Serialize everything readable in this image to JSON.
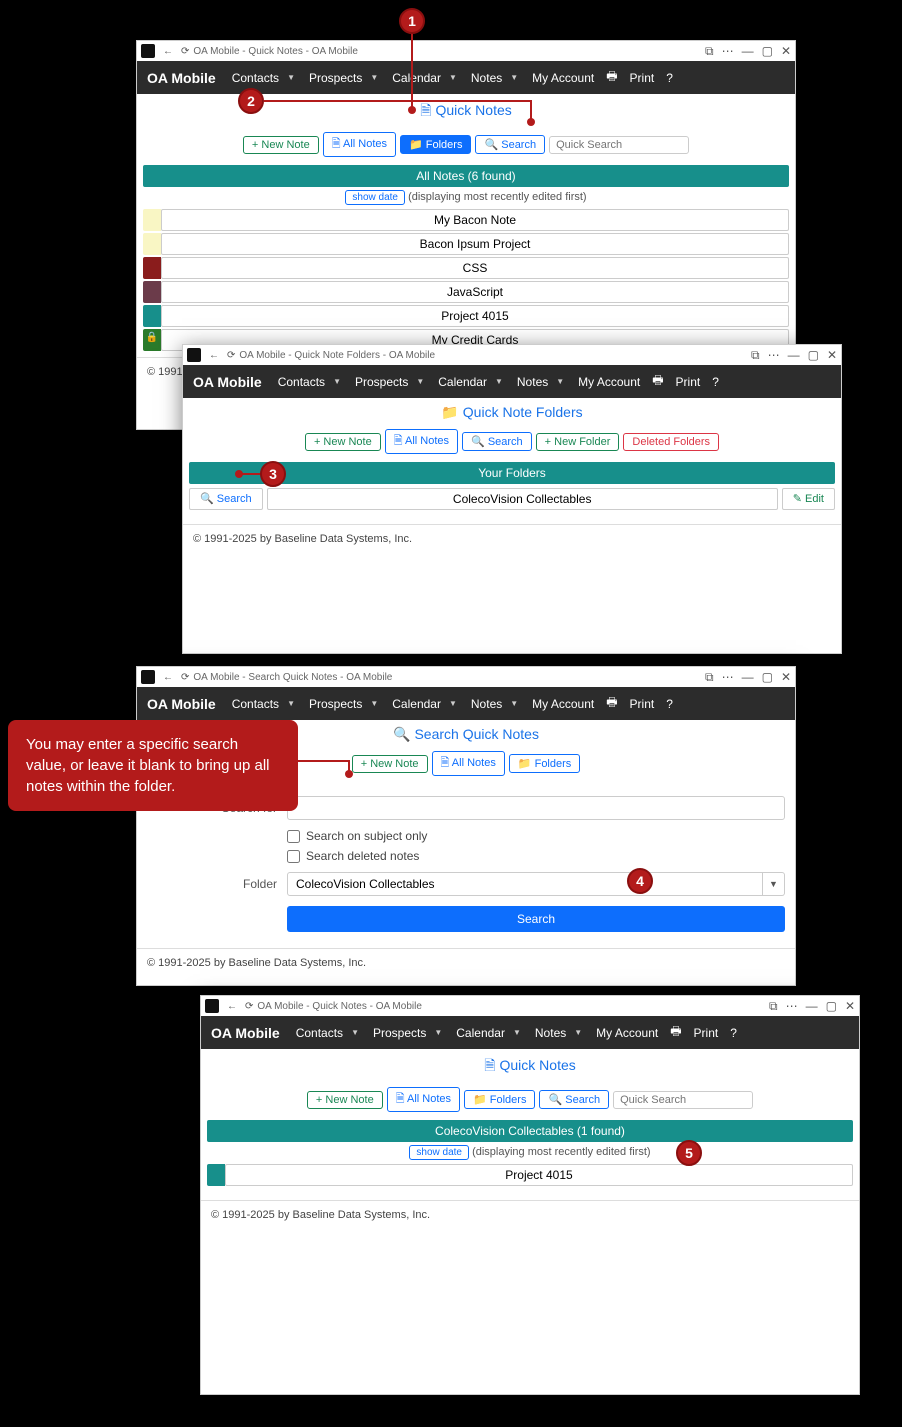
{
  "common": {
    "brand": "OA Mobile",
    "menu": [
      "Contacts",
      "Prospects",
      "Calendar",
      "Notes",
      "My Account"
    ],
    "print": "Print",
    "help": "?",
    "footer": "© 1991-2025 by Baseline Data Systems, Inc.",
    "btn_new_note": "+ New Note",
    "btn_all_notes": "All Notes",
    "btn_folders": "Folders",
    "btn_search": "Search",
    "quick_search_ph": "Quick Search",
    "show_date": "show date",
    "recent_text": "(displaying most recently edited first)"
  },
  "callout_text": "You may enter a specific search value, or leave it blank to bring up all notes within the folder.",
  "markers": {
    "m1": "1",
    "m2": "2",
    "m3": "3",
    "m4": "4",
    "m5": "5"
  },
  "win1": {
    "title": "OA Mobile - Quick Notes - OA Mobile",
    "page_title": "Quick Notes",
    "section": "All Notes (6 found)",
    "notes": [
      {
        "color": "#f9f6c4",
        "label": "My Bacon Note"
      },
      {
        "color": "#f9f6c4",
        "label": "Bacon Ipsum Project"
      },
      {
        "color": "#8a1c1c",
        "label": "CSS"
      },
      {
        "color": "#6b3b4a",
        "label": "JavaScript"
      },
      {
        "color": "#178f8b",
        "label": "Project 4015"
      },
      {
        "color": "#2a7a2a",
        "label": "My Credit Cards",
        "locked": true
      }
    ]
  },
  "win2": {
    "title": "OA Mobile - Quick Note Folders - OA Mobile",
    "page_title": "Quick Note Folders",
    "btn_new_folder": "+ New Folder",
    "btn_deleted": "Deleted Folders",
    "section": "Your Folders",
    "search_label": "Search",
    "folder_name": "ColecoVision Collectables",
    "edit_label": "Edit"
  },
  "win3": {
    "title": "OA Mobile - Search Quick Notes - OA Mobile",
    "page_title": "Search Quick Notes",
    "lbl_search_for": "Search for",
    "chk_subject": "Search on subject only",
    "chk_deleted": "Search deleted notes",
    "lbl_folder": "Folder",
    "sel_folder": "ColecoVision Collectables",
    "btn_do_search": "Search"
  },
  "win4": {
    "title": "OA Mobile - Quick Notes - OA Mobile",
    "page_title": "Quick Notes",
    "section": "ColecoVision Collectables (1 found)",
    "notes": [
      {
        "color": "#178f8b",
        "label": "Project 4015"
      }
    ]
  }
}
